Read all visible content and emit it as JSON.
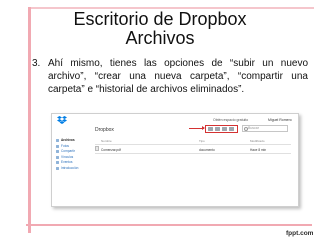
{
  "slide": {
    "title_line1": "Escritorio de Dropbox",
    "title_line2": "Archivos",
    "bullet_number": "3.",
    "bullet_text": "Ahí mismo, tienes las opciones de “subir un nuevo archivo”, “crear una nueva carpeta”, “compartir una carpeta” e “historial de archivos eliminados”."
  },
  "screenshot": {
    "banner": "Obtén espacio gratuito",
    "user": "Miguel Romero",
    "heading": "Dropbox",
    "search_placeholder": "Buscar",
    "sidebar": [
      "Archivos",
      "Fotos",
      "Compartir",
      "Vínculos",
      "Eventos",
      "Introducción"
    ],
    "columns": [
      "Nombre",
      "Tipo",
      "Modificado"
    ],
    "rows": [
      {
        "name": "Comenzar.pdf",
        "type": "documento",
        "modified": "Hace 8 min"
      }
    ],
    "toolbar_icons": [
      "upload-icon",
      "new-folder-icon",
      "share-folder-icon",
      "deleted-files-icon"
    ],
    "accent_color": "#d43232"
  },
  "footer": {
    "logo": "fppt.com"
  }
}
